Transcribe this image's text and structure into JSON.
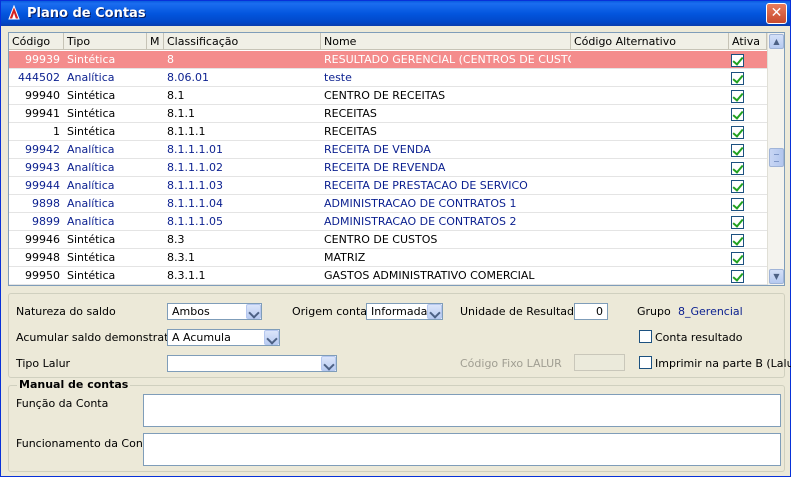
{
  "window": {
    "title": "Plano de Contas",
    "close_label": "✕"
  },
  "grid": {
    "headers": {
      "codigo": "Código",
      "tipo": "Tipo",
      "m": "M",
      "classificacao": "Classificação",
      "nome": "Nome",
      "codigo_alternativo": "Código Alternativo",
      "ativa": "Ativa"
    },
    "rows": [
      {
        "codigo": "99939",
        "tipo": "Sintética",
        "classificacao": "8",
        "nome": "RESULTADO GERENCIAL (CENTROS DE CUSTO)",
        "ativa": true,
        "selected": true,
        "blue": false
      },
      {
        "codigo": "444502",
        "tipo": "Analítica",
        "classificacao": "8.06.01",
        "nome": "teste",
        "ativa": true,
        "selected": false,
        "blue": true
      },
      {
        "codigo": "99940",
        "tipo": "Sintética",
        "classificacao": "8.1",
        "nome": "CENTRO DE RECEITAS",
        "ativa": true,
        "selected": false,
        "blue": false
      },
      {
        "codigo": "99941",
        "tipo": "Sintética",
        "classificacao": "8.1.1",
        "nome": "RECEITAS",
        "ativa": true,
        "selected": false,
        "blue": false
      },
      {
        "codigo": "1",
        "tipo": "Sintética",
        "classificacao": "8.1.1.1",
        "nome": "RECEITAS",
        "ativa": true,
        "selected": false,
        "blue": false
      },
      {
        "codigo": "99942",
        "tipo": "Analítica",
        "classificacao": "8.1.1.1.01",
        "nome": "RECEITA DE VENDA",
        "ativa": true,
        "selected": false,
        "blue": true
      },
      {
        "codigo": "99943",
        "tipo": "Analítica",
        "classificacao": "8.1.1.1.02",
        "nome": "RECEITA DE REVENDA",
        "ativa": true,
        "selected": false,
        "blue": true
      },
      {
        "codigo": "99944",
        "tipo": "Analítica",
        "classificacao": "8.1.1.1.03",
        "nome": "RECEITA DE PRESTACAO DE SERVICO",
        "ativa": true,
        "selected": false,
        "blue": true
      },
      {
        "codigo": "9898",
        "tipo": "Analítica",
        "classificacao": "8.1.1.1.04",
        "nome": "ADMINISTRACAO DE CONTRATOS 1",
        "ativa": true,
        "selected": false,
        "blue": true
      },
      {
        "codigo": "9899",
        "tipo": "Analítica",
        "classificacao": "8.1.1.1.05",
        "nome": "ADMINISTRACAO DE CONTRATOS 2",
        "ativa": true,
        "selected": false,
        "blue": true
      },
      {
        "codigo": "99946",
        "tipo": "Sintética",
        "classificacao": "8.3",
        "nome": "CENTRO DE CUSTOS",
        "ativa": true,
        "selected": false,
        "blue": false
      },
      {
        "codigo": "99948",
        "tipo": "Sintética",
        "classificacao": "8.3.1",
        "nome": "MATRIZ",
        "ativa": true,
        "selected": false,
        "blue": false
      },
      {
        "codigo": "99950",
        "tipo": "Sintética",
        "classificacao": "8.3.1.1",
        "nome": "GASTOS ADMINISTRATIVO COMERCIAL",
        "ativa": true,
        "selected": false,
        "blue": false
      }
    ]
  },
  "form": {
    "natureza_label": "Natureza do saldo",
    "natureza_value": "Ambos",
    "origem_label": "Origem conta",
    "origem_value": "Informada",
    "unidade_label": "Unidade de Resultado",
    "unidade_value": "0",
    "grupo_label": "Grupo",
    "grupo_value": "8_Gerencial",
    "acumular_label": "Acumular saldo demonstrativo",
    "acumular_value": "A  Acumula",
    "conta_resultado_label": "Conta resultado",
    "tipo_lalur_label": "Tipo Lalur",
    "tipo_lalur_value": "",
    "codigo_fixo_label": "Código Fixo LALUR",
    "codigo_fixo_value": "",
    "imprimir_label": "Imprimir na parte B (Lalur)"
  },
  "manual": {
    "title": "Manual de contas",
    "funcao_label": "Função da Conta",
    "funcao_value": "",
    "funcionamento_label": "Funcionamento da Conta",
    "funcionamento_value": ""
  }
}
